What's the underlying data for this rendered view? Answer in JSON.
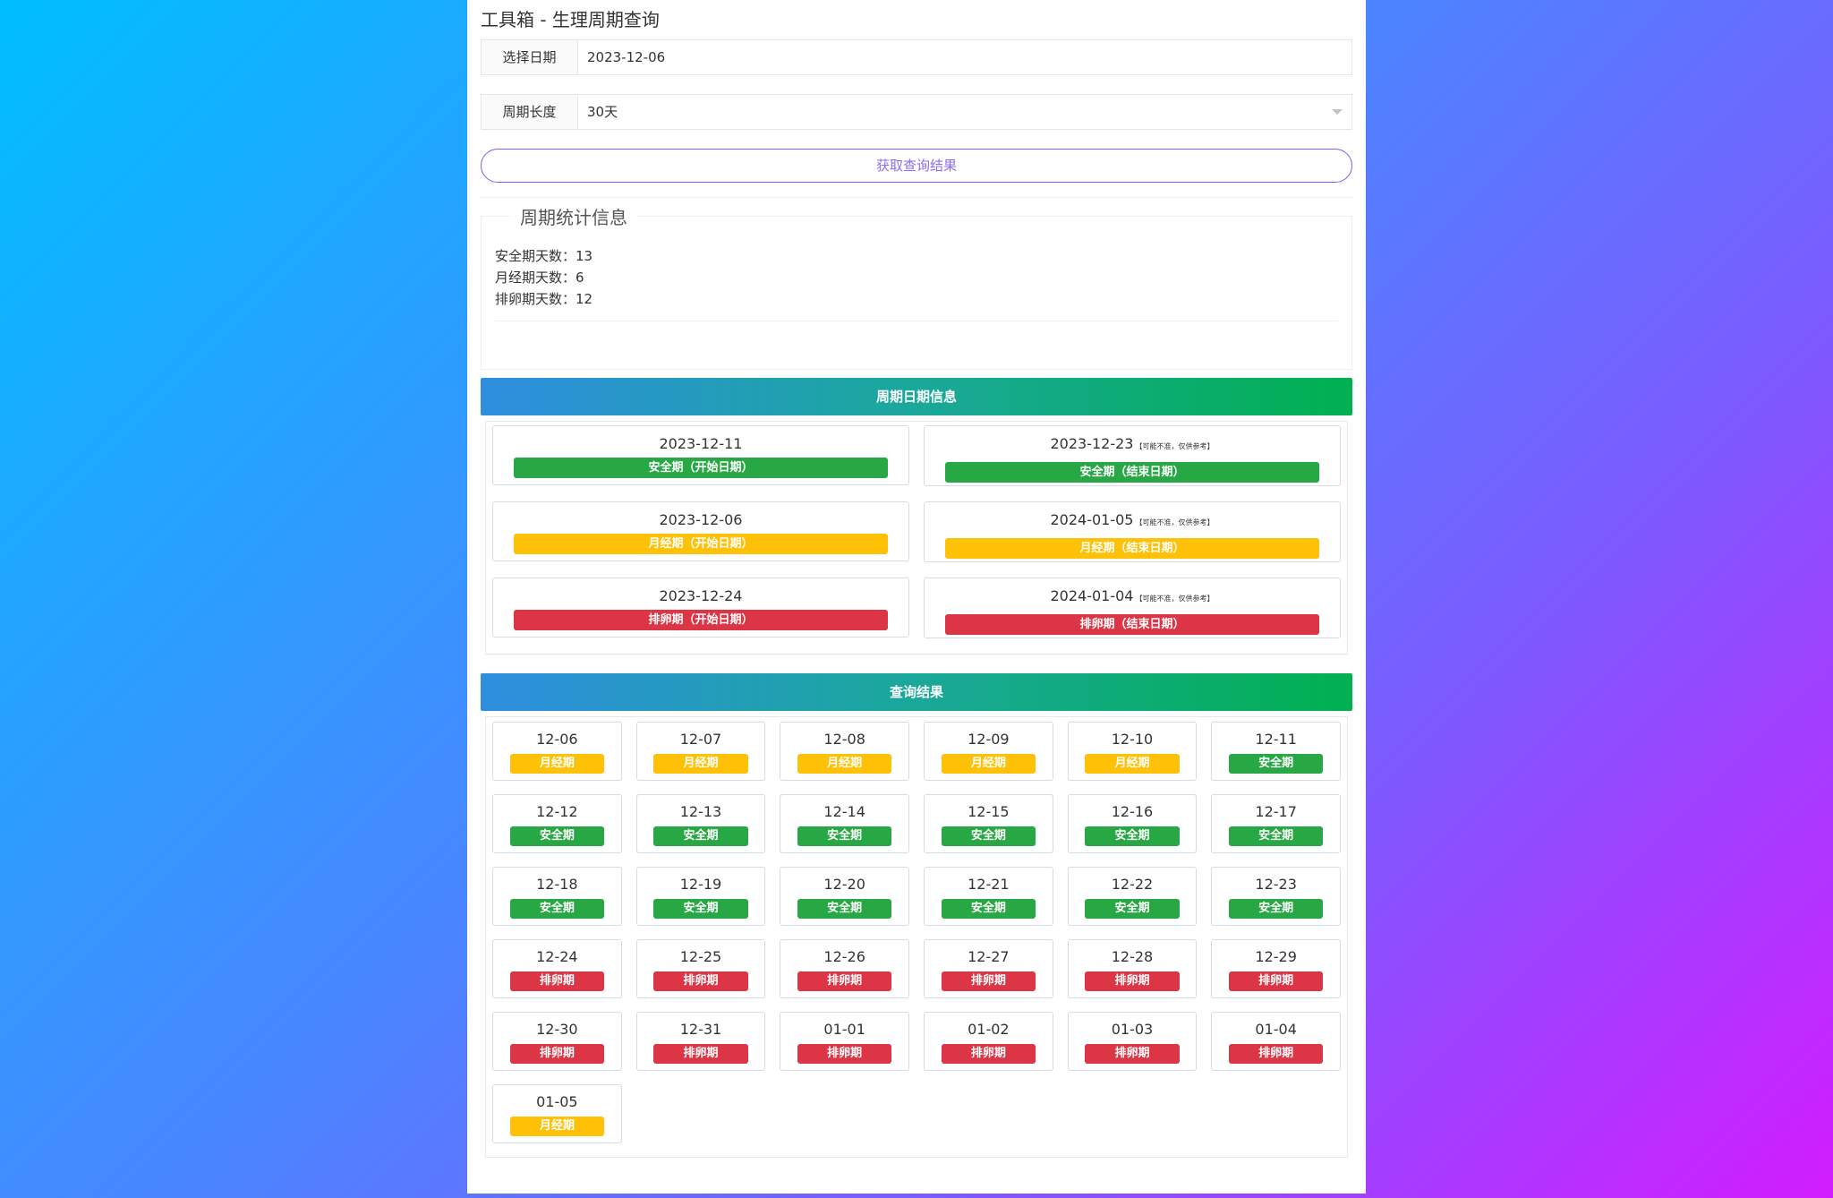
{
  "title": "工具箱 - 生理周期查询",
  "form": {
    "date_label": "选择日期",
    "date_value": "2023-12-06",
    "cycle_label": "周期长度",
    "cycle_value": "30天",
    "query_button": "获取查询结果"
  },
  "stats": {
    "legend": "周期统计信息",
    "lines": [
      "安全期天数：13",
      "月经期天数：6",
      "排卵期天数：12"
    ]
  },
  "period_info": {
    "heading": "周期日期信息",
    "cards": [
      {
        "date": "2023-12-11",
        "note": "",
        "label": "安全期（开始日期）",
        "type": "safe"
      },
      {
        "date": "2023-12-23",
        "note": "【可能不准，仅供参考】",
        "label": "安全期（结束日期）",
        "type": "safe"
      },
      {
        "date": "2023-12-06",
        "note": "",
        "label": "月经期（开始日期）",
        "type": "men"
      },
      {
        "date": "2024-01-05",
        "note": "【可能不准，仅供参考】",
        "label": "月经期（结束日期）",
        "type": "men"
      },
      {
        "date": "2023-12-24",
        "note": "",
        "label": "排卵期（开始日期）",
        "type": "ovu"
      },
      {
        "date": "2024-01-04",
        "note": "【可能不准，仅供参考】",
        "label": "排卵期（结束日期）",
        "type": "ovu"
      }
    ]
  },
  "results": {
    "heading": "查询结果",
    "days": [
      {
        "date": "12-06",
        "label": "月经期",
        "type": "men"
      },
      {
        "date": "12-07",
        "label": "月经期",
        "type": "men"
      },
      {
        "date": "12-08",
        "label": "月经期",
        "type": "men"
      },
      {
        "date": "12-09",
        "label": "月经期",
        "type": "men"
      },
      {
        "date": "12-10",
        "label": "月经期",
        "type": "men"
      },
      {
        "date": "12-11",
        "label": "安全期",
        "type": "safe"
      },
      {
        "date": "12-12",
        "label": "安全期",
        "type": "safe"
      },
      {
        "date": "12-13",
        "label": "安全期",
        "type": "safe"
      },
      {
        "date": "12-14",
        "label": "安全期",
        "type": "safe"
      },
      {
        "date": "12-15",
        "label": "安全期",
        "type": "safe"
      },
      {
        "date": "12-16",
        "label": "安全期",
        "type": "safe"
      },
      {
        "date": "12-17",
        "label": "安全期",
        "type": "safe"
      },
      {
        "date": "12-18",
        "label": "安全期",
        "type": "safe"
      },
      {
        "date": "12-19",
        "label": "安全期",
        "type": "safe"
      },
      {
        "date": "12-20",
        "label": "安全期",
        "type": "safe"
      },
      {
        "date": "12-21",
        "label": "安全期",
        "type": "safe"
      },
      {
        "date": "12-22",
        "label": "安全期",
        "type": "safe"
      },
      {
        "date": "12-23",
        "label": "安全期",
        "type": "safe"
      },
      {
        "date": "12-24",
        "label": "排卵期",
        "type": "ovu"
      },
      {
        "date": "12-25",
        "label": "排卵期",
        "type": "ovu"
      },
      {
        "date": "12-26",
        "label": "排卵期",
        "type": "ovu"
      },
      {
        "date": "12-27",
        "label": "排卵期",
        "type": "ovu"
      },
      {
        "date": "12-28",
        "label": "排卵期",
        "type": "ovu"
      },
      {
        "date": "12-29",
        "label": "排卵期",
        "type": "ovu"
      },
      {
        "date": "12-30",
        "label": "排卵期",
        "type": "ovu"
      },
      {
        "date": "12-31",
        "label": "排卵期",
        "type": "ovu"
      },
      {
        "date": "01-01",
        "label": "排卵期",
        "type": "ovu"
      },
      {
        "date": "01-02",
        "label": "排卵期",
        "type": "ovu"
      },
      {
        "date": "01-03",
        "label": "排卵期",
        "type": "ovu"
      },
      {
        "date": "01-04",
        "label": "排卵期",
        "type": "ovu"
      },
      {
        "date": "01-05",
        "label": "月经期",
        "type": "men"
      }
    ]
  },
  "colors": {
    "safe": "#28a745",
    "men": "#ffc107",
    "ovu": "#dc3545",
    "button_border": "#7c5cff"
  }
}
